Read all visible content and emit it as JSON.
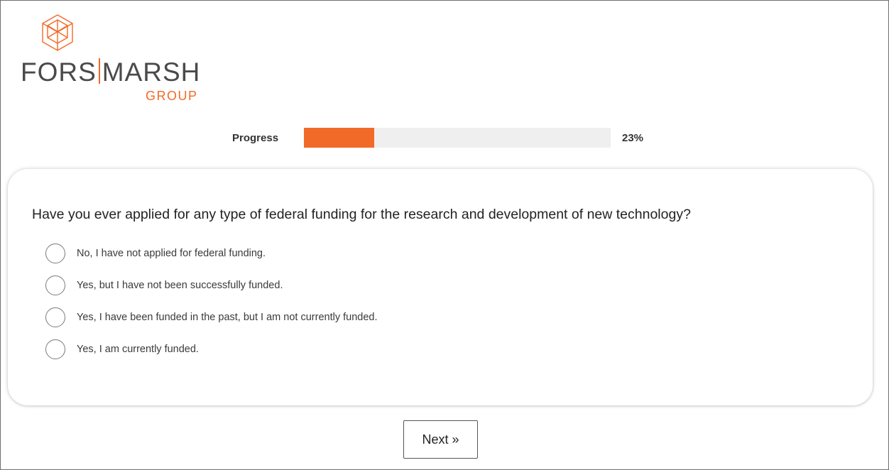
{
  "logo": {
    "word_left": "FORS",
    "word_right": "MARSH",
    "sub": "GROUP",
    "accent_color": "#f26a28",
    "mark_icon": "cube-icon"
  },
  "progress": {
    "label": "Progress",
    "value_text": "23%",
    "value": 0.23,
    "fill_color": "#f26a28"
  },
  "question": {
    "text": "Have you ever applied for any type of federal funding for the research and development of new technology?",
    "options": [
      {
        "label": "No, I have not applied for federal funding."
      },
      {
        "label": "Yes, but I have not been successfully funded."
      },
      {
        "label": "Yes, I have been funded in the past, but I am not currently funded."
      },
      {
        "label": "Yes, I am currently funded."
      }
    ]
  },
  "navigation": {
    "next_label": "Next »"
  }
}
